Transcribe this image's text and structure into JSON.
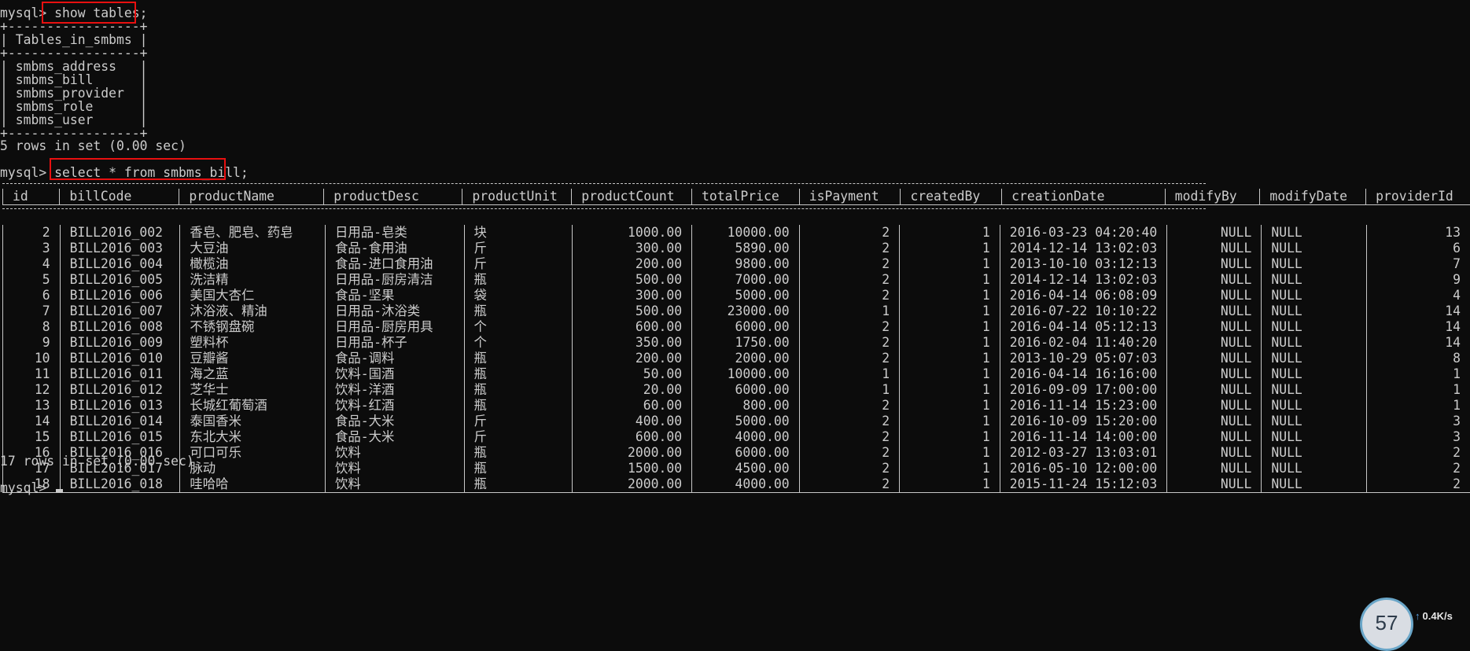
{
  "prompt": "mysql>",
  "cmd1": "show tables;",
  "tables": {
    "header": "Tables_in_smbms",
    "rows": [
      "smbms_address",
      "smbms_bill",
      "smbms_provider",
      "smbms_role",
      "smbms_user"
    ],
    "footer": "5 rows in set (0.00 sec)"
  },
  "cmd2": "select * from smbms_bill;",
  "bill": {
    "columns": [
      "id",
      "billCode",
      "productName",
      "productDesc",
      "productUnit",
      "productCount",
      "totalPrice",
      "isPayment",
      "createdBy",
      "creationDate",
      "modifyBy",
      "modifyDate",
      "providerId"
    ],
    "align": [
      "r",
      "l",
      "l",
      "l",
      "l",
      "r",
      "r",
      "r",
      "r",
      "l",
      "r",
      "l",
      "r"
    ],
    "rows": [
      [
        "2",
        "BILL2016_002",
        "香皂、肥皂、药皂",
        "日用品-皂类",
        "块",
        "1000.00",
        "10000.00",
        "2",
        "1",
        "2016-03-23 04:20:40",
        "NULL",
        "NULL",
        "13"
      ],
      [
        "3",
        "BILL2016_003",
        "大豆油",
        "食品-食用油",
        "斤",
        "300.00",
        "5890.00",
        "2",
        "1",
        "2014-12-14 13:02:03",
        "NULL",
        "NULL",
        "6"
      ],
      [
        "4",
        "BILL2016_004",
        "橄榄油",
        "食品-进口食用油",
        "斤",
        "200.00",
        "9800.00",
        "2",
        "1",
        "2013-10-10 03:12:13",
        "NULL",
        "NULL",
        "7"
      ],
      [
        "5",
        "BILL2016_005",
        "洗洁精",
        "日用品-厨房清洁",
        "瓶",
        "500.00",
        "7000.00",
        "2",
        "1",
        "2014-12-14 13:02:03",
        "NULL",
        "NULL",
        "9"
      ],
      [
        "6",
        "BILL2016_006",
        "美国大杏仁",
        "食品-坚果",
        "袋",
        "300.00",
        "5000.00",
        "2",
        "1",
        "2016-04-14 06:08:09",
        "NULL",
        "NULL",
        "4"
      ],
      [
        "7",
        "BILL2016_007",
        "沐浴液、精油",
        "日用品-沐浴类",
        "瓶",
        "500.00",
        "23000.00",
        "1",
        "1",
        "2016-07-22 10:10:22",
        "NULL",
        "NULL",
        "14"
      ],
      [
        "8",
        "BILL2016_008",
        "不锈钢盘碗",
        "日用品-厨房用具",
        "个",
        "600.00",
        "6000.00",
        "2",
        "1",
        "2016-04-14 05:12:13",
        "NULL",
        "NULL",
        "14"
      ],
      [
        "9",
        "BILL2016_009",
        "塑料杯",
        "日用品-杯子",
        "个",
        "350.00",
        "1750.00",
        "2",
        "1",
        "2016-02-04 11:40:20",
        "NULL",
        "NULL",
        "14"
      ],
      [
        "10",
        "BILL2016_010",
        "豆瓣酱",
        "食品-调料",
        "瓶",
        "200.00",
        "2000.00",
        "2",
        "1",
        "2013-10-29 05:07:03",
        "NULL",
        "NULL",
        "8"
      ],
      [
        "11",
        "BILL2016_011",
        "海之蓝",
        "饮料-国酒",
        "瓶",
        "50.00",
        "10000.00",
        "1",
        "1",
        "2016-04-14 16:16:00",
        "NULL",
        "NULL",
        "1"
      ],
      [
        "12",
        "BILL2016_012",
        "芝华士",
        "饮料-洋酒",
        "瓶",
        "20.00",
        "6000.00",
        "1",
        "1",
        "2016-09-09 17:00:00",
        "NULL",
        "NULL",
        "1"
      ],
      [
        "13",
        "BILL2016_013",
        "长城红葡萄酒",
        "饮料-红酒",
        "瓶",
        "60.00",
        "800.00",
        "2",
        "1",
        "2016-11-14 15:23:00",
        "NULL",
        "NULL",
        "1"
      ],
      [
        "14",
        "BILL2016_014",
        "泰国香米",
        "食品-大米",
        "斤",
        "400.00",
        "5000.00",
        "2",
        "1",
        "2016-10-09 15:20:00",
        "NULL",
        "NULL",
        "3"
      ],
      [
        "15",
        "BILL2016_015",
        "东北大米",
        "食品-大米",
        "斤",
        "600.00",
        "4000.00",
        "2",
        "1",
        "2016-11-14 14:00:00",
        "NULL",
        "NULL",
        "3"
      ],
      [
        "16",
        "BILL2016_016",
        "可口可乐",
        "饮料",
        "瓶",
        "2000.00",
        "6000.00",
        "2",
        "1",
        "2012-03-27 13:03:01",
        "NULL",
        "NULL",
        "2"
      ],
      [
        "17",
        "BILL2016_017",
        "脉动",
        "饮料",
        "瓶",
        "1500.00",
        "4500.00",
        "2",
        "1",
        "2016-05-10 12:00:00",
        "NULL",
        "NULL",
        "2"
      ],
      [
        "18",
        "BILL2016_018",
        "哇哈哈",
        "饮料",
        "瓶",
        "2000.00",
        "4000.00",
        "2",
        "1",
        "2015-11-24 15:12:03",
        "NULL",
        "NULL",
        "2"
      ]
    ],
    "footer": "17 rows in set (0.00 sec)"
  },
  "widget": {
    "value": "57",
    "speed": "0.4",
    "unit": "K/s"
  }
}
